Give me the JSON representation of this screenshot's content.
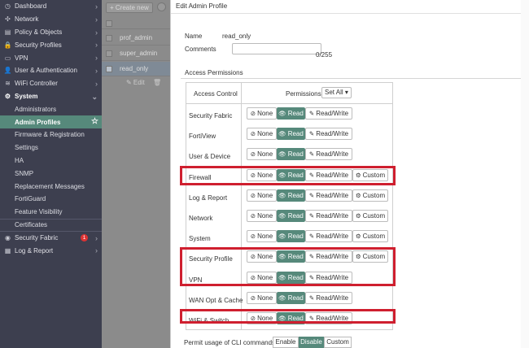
{
  "sidebar": {
    "top_items": [
      {
        "label": "Dashboard",
        "icon": "dashboard-icon",
        "glyph": "◷"
      },
      {
        "label": "Network",
        "icon": "network-icon",
        "glyph": "✣"
      },
      {
        "label": "Policy & Objects",
        "icon": "policy-icon",
        "glyph": "▤"
      },
      {
        "label": "Security Profiles",
        "icon": "lock-icon",
        "glyph": "🔒"
      },
      {
        "label": "VPN",
        "icon": "vpn-icon",
        "glyph": "▭"
      },
      {
        "label": "User & Authentication",
        "icon": "user-icon",
        "glyph": "👤"
      },
      {
        "label": "WiFi Controller",
        "icon": "wifi-icon",
        "glyph": "≋"
      }
    ],
    "system_label": "System",
    "system_items": [
      "Administrators",
      "Admin Profiles",
      "Firmware & Registration",
      "Settings",
      "HA",
      "SNMP",
      "Replacement Messages",
      "FortiGuard",
      "Feature Visibility",
      "Certificates"
    ],
    "security_fabric_label": "Security Fabric",
    "security_fabric_badge": "1",
    "log_report_label": "Log & Report"
  },
  "list": {
    "create_new": "+ Create new",
    "rows": [
      "prof_admin",
      "super_admin",
      "read_only"
    ],
    "edit_label": "✎ Edit",
    "trash_glyph": "🗑"
  },
  "dialog": {
    "title": "Edit Admin Profile",
    "name_label": "Name",
    "name_value": "read_only",
    "comments_label": "Comments",
    "comments_counter": "0/255",
    "section_title": "Access Permissions",
    "col_access": "Access Control",
    "col_permissions": "Permissions",
    "set_all": "Set All ▾",
    "btn_none": "None",
    "btn_read": "Read",
    "btn_rw": "Read/Write",
    "btn_custom": "Custom",
    "rows": [
      {
        "label": "Security Fabric",
        "custom": false
      },
      {
        "label": "FortiView",
        "custom": false
      },
      {
        "label": "User & Device",
        "custom": false
      },
      {
        "label": "Firewall",
        "custom": true
      },
      {
        "label": "Log & Report",
        "custom": true
      },
      {
        "label": "Network",
        "custom": true
      },
      {
        "label": "System",
        "custom": true
      },
      {
        "label": "Security Profile",
        "custom": true
      },
      {
        "label": "VPN",
        "custom": false
      },
      {
        "label": "WAN Opt & Cache",
        "custom": false
      },
      {
        "label": "WiFi & Switch",
        "custom": false
      }
    ],
    "selected_permission": "Read",
    "cli_label": "Permit usage of CLI commands",
    "cli_options": [
      "Enable",
      "Disable",
      "Custom"
    ],
    "cli_selected": "Disable",
    "accent_color": "#56897b",
    "highlight_color": "#cf1f2f"
  }
}
